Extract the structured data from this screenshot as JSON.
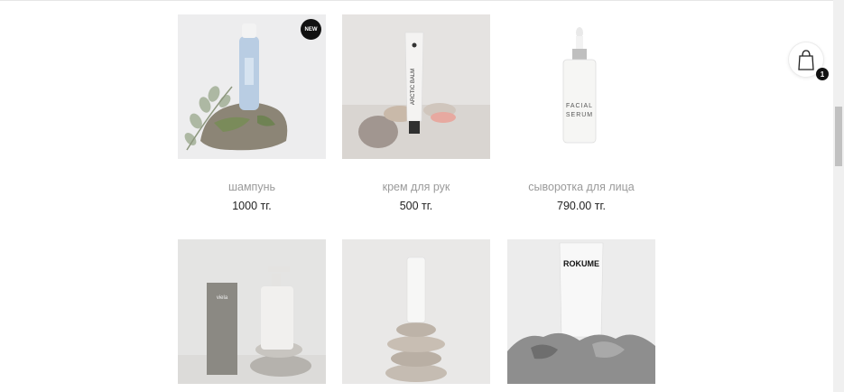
{
  "products": [
    {
      "title": "шампунь",
      "price": "1000 тг.",
      "badge": "NEW",
      "label": ""
    },
    {
      "title": "крем для рук",
      "price": "500 тг.",
      "badge": "",
      "label": "ARCTIC BALM"
    },
    {
      "title": "сыворотка для лица",
      "price": "790.00 тг.",
      "badge": "",
      "label_1": "FACIAL",
      "label_2": "SERUM"
    },
    {
      "title": "",
      "price": "",
      "badge": "",
      "brand": "viela"
    },
    {
      "title": "",
      "price": "",
      "badge": "",
      "label": ""
    },
    {
      "title": "",
      "price": "",
      "badge": "",
      "brand": "ROKUME"
    }
  ],
  "cart": {
    "count": "1"
  },
  "colors": {
    "text_title": "#9a9a9a",
    "text_price": "#222222",
    "badge_bg": "#111111"
  }
}
